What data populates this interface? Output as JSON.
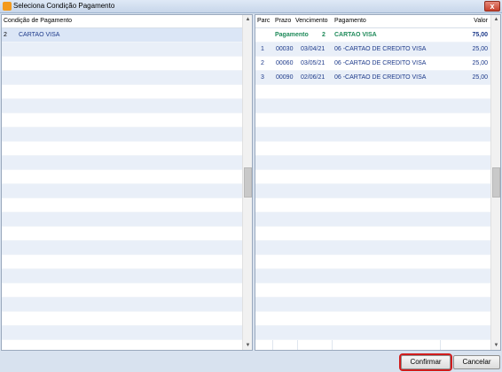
{
  "window": {
    "title": "Seleciona Condição Pagamento",
    "close_label": "x"
  },
  "left": {
    "header": "Condição de Pagamento",
    "row_marker": "2",
    "items": [
      "CARTAO VISA"
    ]
  },
  "right": {
    "headers": {
      "parc": "Parc",
      "prazo": "Prazo",
      "vencimento": "Vencimento",
      "pagamento": "Pagamento",
      "valor": "Valor"
    },
    "summary": {
      "label": "Pagamento",
      "count": "2",
      "condition": "CARTAO VISA",
      "total": "75,00"
    },
    "rows": [
      {
        "parc": "1",
        "prazo": "00030",
        "vencimento": "03/04/21",
        "pagamento": "06 -CARTAO DE CREDITO VISA",
        "valor": "25,00"
      },
      {
        "parc": "2",
        "prazo": "00060",
        "vencimento": "03/05/21",
        "pagamento": "06 -CARTAO DE CREDITO VISA",
        "valor": "25,00"
      },
      {
        "parc": "3",
        "prazo": "00090",
        "vencimento": "02/06/21",
        "pagamento": "06 -CARTAO DE CREDITO VISA",
        "valor": "25,00"
      }
    ]
  },
  "buttons": {
    "confirm": "Confirmar",
    "cancel": "Cancelar"
  },
  "colors": {
    "accent_green": "#1f8a5a",
    "text_blue": "#1d3a8a",
    "highlight": "#d01c1c"
  }
}
